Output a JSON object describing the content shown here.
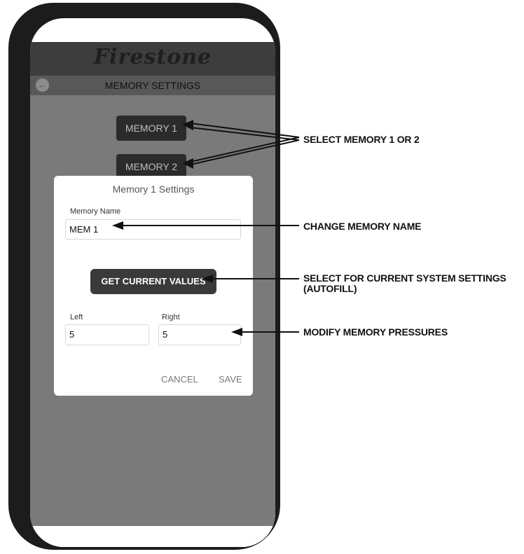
{
  "app": {
    "logo": "Firestone",
    "title": "MEMORY SETTINGS"
  },
  "memory_buttons": {
    "memory1": "MEMORY 1",
    "memory2": "MEMORY 2"
  },
  "dialog": {
    "title": "Memory 1 Settings",
    "memory_name_label": "Memory Name",
    "memory_name_value": "MEM 1",
    "get_values_label": "GET CURRENT VALUES",
    "left_label": "Left",
    "left_value": "5",
    "right_label": "Right",
    "right_value": "5",
    "cancel_label": "CANCEL",
    "save_label": "SAVE"
  },
  "annotations": {
    "select_memory": "SELECT MEMORY 1 OR 2",
    "change_name": "CHANGE MEMORY NAME",
    "current_settings_line1": "SELECT FOR CURRENT SYSTEM SETTINGS",
    "current_settings_line2": "(AUTOFILL)",
    "modify_pressures": "MODIFY MEMORY PRESSURES"
  },
  "icons": {
    "back": "back-arrow-icon"
  }
}
